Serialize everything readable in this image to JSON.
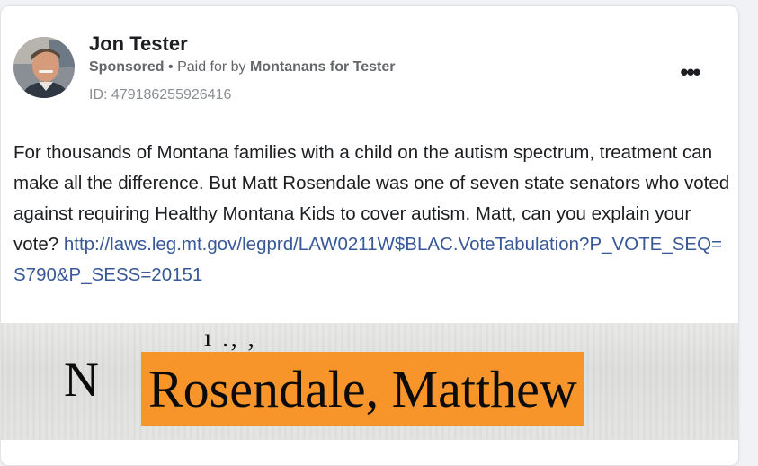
{
  "post": {
    "author_name": "Jon Tester",
    "sponsored_label": "Sponsored",
    "separator": " • ",
    "paid_for_prefix": "Paid for by ",
    "paid_for_name": "Montanans for Tester",
    "ad_id": "ID: 479186255926416",
    "more_icon": "more-options-icon",
    "text": "For thousands of Montana families with a child on the autism spectrum, treatment can make all the difference. But Matt Rosendale was one of seven state senators who voted against requiring Healthy Montana Kids to cover autism. Matt, can you explain your vote?",
    "link": "http://laws.leg.mt.gov/legprd/LAW0211W$BLAC.VoteTabulation?P_VOTE_SEQ=S790&P_SESS=20151"
  },
  "image": {
    "partial_top_text": "ı ., ,",
    "vote_letter": "N",
    "highlighted_name": "Rosendale, Matthew",
    "highlight_color": "#f7952b"
  }
}
